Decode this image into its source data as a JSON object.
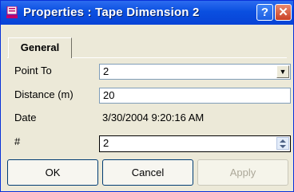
{
  "window": {
    "title": "Properties : Tape Dimension 2"
  },
  "tabs": [
    {
      "label": "General"
    }
  ],
  "fields": {
    "point_to": {
      "label": "Point To",
      "value": "2"
    },
    "distance": {
      "label": "Distance (m)",
      "value": "20"
    },
    "date": {
      "label": "Date",
      "value": "3/30/2004 9:20:16 AM"
    },
    "number": {
      "label": "#",
      "value": "2"
    }
  },
  "buttons": {
    "ok": "OK",
    "cancel": "Cancel",
    "apply": "Apply"
  },
  "icons": {
    "help": "?",
    "close": "✕",
    "dropdown": "▼"
  }
}
